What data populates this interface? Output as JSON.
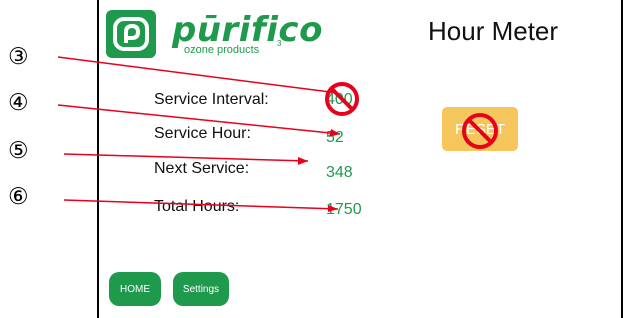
{
  "brand": {
    "name": "pūrifico",
    "tagline": "ozone products",
    "superscript": "3",
    "brand_color": "#1f9a4d"
  },
  "header": {
    "title": "Hour Meter"
  },
  "fields": [
    {
      "label": "Service Interval:",
      "value": "400",
      "marker": "③"
    },
    {
      "label": "Service Hour:",
      "value": "52",
      "marker": "④"
    },
    {
      "label": "Next Service:",
      "value": "348",
      "marker": "⑤"
    },
    {
      "label": "Total Hours:",
      "value": "1750",
      "marker": "⑥"
    }
  ],
  "reset": {
    "label": "RESET",
    "color": "#f5c04a"
  },
  "nav": {
    "home_label": "HOME",
    "settings_label": "Settings"
  },
  "annotation": {
    "color": "#e8001c",
    "icon": "prohibited-icon"
  }
}
